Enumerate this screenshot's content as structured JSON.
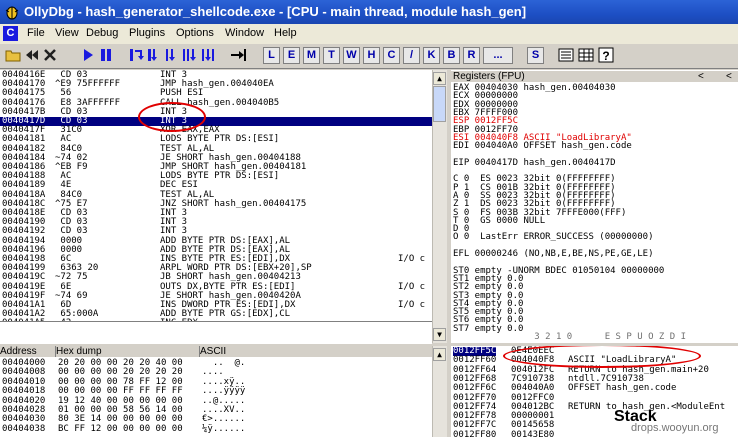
{
  "title": "OllyDbg - hash_generator_shellcode.exe - [CPU - main thread, module hash_gen]",
  "menu": [
    "File",
    "View",
    "Debug",
    "Plugins",
    "Options",
    "Window",
    "Help"
  ],
  "menu_icon_letter": "C",
  "toolbar_letters": [
    "L",
    "E",
    "M",
    "T",
    "W",
    "H",
    "C",
    "/",
    "K",
    "B",
    "R",
    "...",
    "S"
  ],
  "disasm": [
    {
      "addr": "0040416E",
      "hex": " CD 03",
      "instr": "INT 3",
      "cmt": ""
    },
    {
      "addr": "00404170",
      "hex": "^E9 75FFFFFF",
      "instr": "JMP hash_gen.004040EA",
      "cmt": ""
    },
    {
      "addr": "00404175",
      "hex": " 56",
      "instr": "PUSH ESI",
      "cmt": ""
    },
    {
      "addr": "00404176",
      "hex": " E8 3AFFFFFF",
      "instr": "CALL hash_gen.004040B5",
      "cmt": ""
    },
    {
      "addr": "0040417B",
      "hex": " CD 03",
      "instr": "INT 3",
      "cmt": ""
    },
    {
      "addr": "0040417D",
      "hex": " CD 03",
      "instr": "INT 3",
      "cmt": ""
    },
    {
      "addr": "0040417F",
      "hex": " 31C0",
      "instr": "XOR EAX,EAX",
      "cmt": ""
    },
    {
      "addr": "00404181",
      "hex": " AC",
      "instr": "LODS BYTE PTR DS:[ESI]",
      "cmt": ""
    },
    {
      "addr": "00404182",
      "hex": " 84C0",
      "instr": "TEST AL,AL",
      "cmt": ""
    },
    {
      "addr": "00404184",
      "hex": "~74 02",
      "instr": "JE SHORT hash_gen.00404188",
      "cmt": ""
    },
    {
      "addr": "00404186",
      "hex": "^EB F9",
      "instr": "JMP SHORT hash_gen.00404181",
      "cmt": ""
    },
    {
      "addr": "00404188",
      "hex": " AC",
      "instr": "LODS BYTE PTR DS:[ESI]",
      "cmt": ""
    },
    {
      "addr": "00404189",
      "hex": " 4E",
      "instr": "DEC ESI",
      "cmt": ""
    },
    {
      "addr": "0040418A",
      "hex": " 84C0",
      "instr": "TEST AL,AL",
      "cmt": ""
    },
    {
      "addr": "0040418C",
      "hex": "^75 E7",
      "instr": "JNZ SHORT hash_gen.00404175",
      "cmt": ""
    },
    {
      "addr": "0040418E",
      "hex": " CD 03",
      "instr": "INT 3",
      "cmt": ""
    },
    {
      "addr": "00404190",
      "hex": " CD 03",
      "instr": "INT 3",
      "cmt": ""
    },
    {
      "addr": "00404192",
      "hex": " CD 03",
      "instr": "INT 3",
      "cmt": ""
    },
    {
      "addr": "00404194",
      "hex": " 0000",
      "instr": "ADD BYTE PTR DS:[EAX],AL",
      "cmt": ""
    },
    {
      "addr": "00404196",
      "hex": " 0000",
      "instr": "ADD BYTE PTR DS:[EAX],AL",
      "cmt": ""
    },
    {
      "addr": "00404198",
      "hex": " 6C",
      "instr": "INS BYTE PTR ES:[EDI],DX",
      "cmt": "I/O c"
    },
    {
      "addr": "00404199",
      "hex": " 6363 20",
      "instr": "ARPL WORD PTR DS:[EBX+20],SP",
      "cmt": ""
    },
    {
      "addr": "0040419C",
      "hex": "~72 75",
      "instr": "JB SHORT hash_gen.00404213",
      "cmt": ""
    },
    {
      "addr": "0040419E",
      "hex": " 6E",
      "instr": "OUTS DX,BYTE PTR ES:[EDI]",
      "cmt": "I/O c"
    },
    {
      "addr": "0040419F",
      "hex": "~74 69",
      "instr": "JE SHORT hash_gen.0040420A",
      "cmt": ""
    },
    {
      "addr": "004041A1",
      "hex": " 6D",
      "instr": "INS DWORD PTR ES:[EDI],DX",
      "cmt": "I/O c"
    },
    {
      "addr": "004041A2",
      "hex": " 65:000A",
      "instr": "ADD BYTE PTR GS:[EDX],CL",
      "cmt": ""
    },
    {
      "addr": "004041A5",
      "hex": " 42",
      "instr": "INC EDX",
      "cmt": ""
    }
  ],
  "registers_title": "Registers (FPU)",
  "registers": [
    {
      "t": "EAX 00404030 hash_gen.00404030",
      "c": "n"
    },
    {
      "t": "ECX 00000000",
      "c": "n"
    },
    {
      "t": "EDX 00000000",
      "c": "n"
    },
    {
      "t": "EBX 7FFFF000",
      "c": "n"
    },
    {
      "t": "ESP 0012FF5C",
      "c": "r"
    },
    {
      "t": "EBP 0012FF70",
      "c": "n"
    },
    {
      "t": "ESI 004040F8 ASCII \"LoadLibraryA\"",
      "c": "r"
    },
    {
      "t": "EDI 004040A0 OFFSET hash_gen.code",
      "c": "n"
    },
    {
      "t": "",
      "c": "n"
    },
    {
      "t": "EIP 0040417D hash_gen.0040417D",
      "c": "n"
    },
    {
      "t": "",
      "c": "n"
    },
    {
      "t": "C 0  ES 0023 32bit 0(FFFFFFFF)",
      "c": "n"
    },
    {
      "t": "P 1  CS 001B 32bit 0(FFFFFFFF)",
      "c": "n"
    },
    {
      "t": "A 0  SS 0023 32bit 0(FFFFFFFF)",
      "c": "n"
    },
    {
      "t": "Z 1  DS 0023 32bit 0(FFFFFFFF)",
      "c": "n"
    },
    {
      "t": "S 0  FS 003B 32bit 7FFFE000(FFF)",
      "c": "n"
    },
    {
      "t": "T 0  GS 0000 NULL",
      "c": "n"
    },
    {
      "t": "D 0",
      "c": "n"
    },
    {
      "t": "O 0  LastErr ERROR_SUCCESS (00000000)",
      "c": "n"
    },
    {
      "t": "",
      "c": "n"
    },
    {
      "t": "EFL 00000246 (NO,NB,E,BE,NS,PE,GE,LE)",
      "c": "n"
    },
    {
      "t": "",
      "c": "n"
    },
    {
      "t": "ST0 empty -UNORM BDEC 01050104 00000000",
      "c": "n"
    },
    {
      "t": "ST1 empty 0.0",
      "c": "n"
    },
    {
      "t": "ST2 empty 0.0",
      "c": "n"
    },
    {
      "t": "ST3 empty 0.0",
      "c": "n"
    },
    {
      "t": "ST4 empty 0.0",
      "c": "n"
    },
    {
      "t": "ST5 empty 0.0",
      "c": "n"
    },
    {
      "t": "ST6 empty 0.0",
      "c": "n"
    },
    {
      "t": "ST7 empty 0.0",
      "c": "n"
    },
    {
      "t": "               3 2 1 0      E S P U O Z D I",
      "c": "g"
    }
  ],
  "dump_headers": [
    "Address",
    "Hex dump",
    "ASCII"
  ],
  "dump": [
    {
      "addr": "00404000",
      "hex": "20 20 00 00 20 20 40 00",
      "ascii": "  ..  @."
    },
    {
      "addr": "00404008",
      "hex": "00 00 00 00 20 20 20 20",
      "ascii": "....    "
    },
    {
      "addr": "00404010",
      "hex": "00 00 00 00 78 FF 12 00",
      "ascii": "....xÿ.."
    },
    {
      "addr": "00404018",
      "hex": "00 00 00 00 FF FF FF FF",
      "ascii": "....ÿÿÿÿ"
    },
    {
      "addr": "00404020",
      "hex": "19 12 40 00 00 00 00 00",
      "ascii": "..@....."
    },
    {
      "addr": "00404028",
      "hex": "01 00 00 00 58 56 14 00",
      "ascii": "....XV.."
    },
    {
      "addr": "00404030",
      "hex": "80 3E 14 00 00 00 00 00",
      "ascii": "€>......"
    },
    {
      "addr": "00404038",
      "hex": "BC FF 12 00 00 00 00 00",
      "ascii": "¼ÿ......"
    }
  ],
  "stack": [
    {
      "addr": "0012FF5C",
      "val": "0E4E0EEC",
      "cmt": "",
      "sel": true
    },
    {
      "addr": "0012FF60",
      "val": "004040F8",
      "cmt": "ASCII \"LoadLibraryA\"",
      "sel": false
    },
    {
      "addr": "0012FF64",
      "val": "004012FC",
      "cmt": "RETURN to hash_gen.main+20",
      "sel": false
    },
    {
      "addr": "0012FF68",
      "val": "7C910738",
      "cmt": "ntdll.7C910738",
      "sel": false
    },
    {
      "addr": "0012FF6C",
      "val": "004040A0",
      "cmt": "OFFSET hash_gen.code",
      "sel": false
    },
    {
      "addr": "0012FF70",
      "val": "0012FFC0",
      "cmt": "",
      "sel": false
    },
    {
      "addr": "0012FF74",
      "val": "004012BC",
      "cmt": "RETURN to hash_gen.<ModuleEnt",
      "sel": false
    },
    {
      "addr": "0012FF78",
      "val": "00000001",
      "cmt": "",
      "sel": false
    },
    {
      "addr": "0012FF7C",
      "val": "00145658",
      "cmt": "",
      "sel": false
    },
    {
      "addr": "0012FF80",
      "val": "00143E80",
      "cmt": "",
      "sel": false
    }
  ],
  "annotation_stack": "Stack",
  "watermark": "drops.wooyun.org",
  "colors": {
    "title": "#1d4fc4",
    "selection": "#000080",
    "annotation": "#e00000"
  }
}
